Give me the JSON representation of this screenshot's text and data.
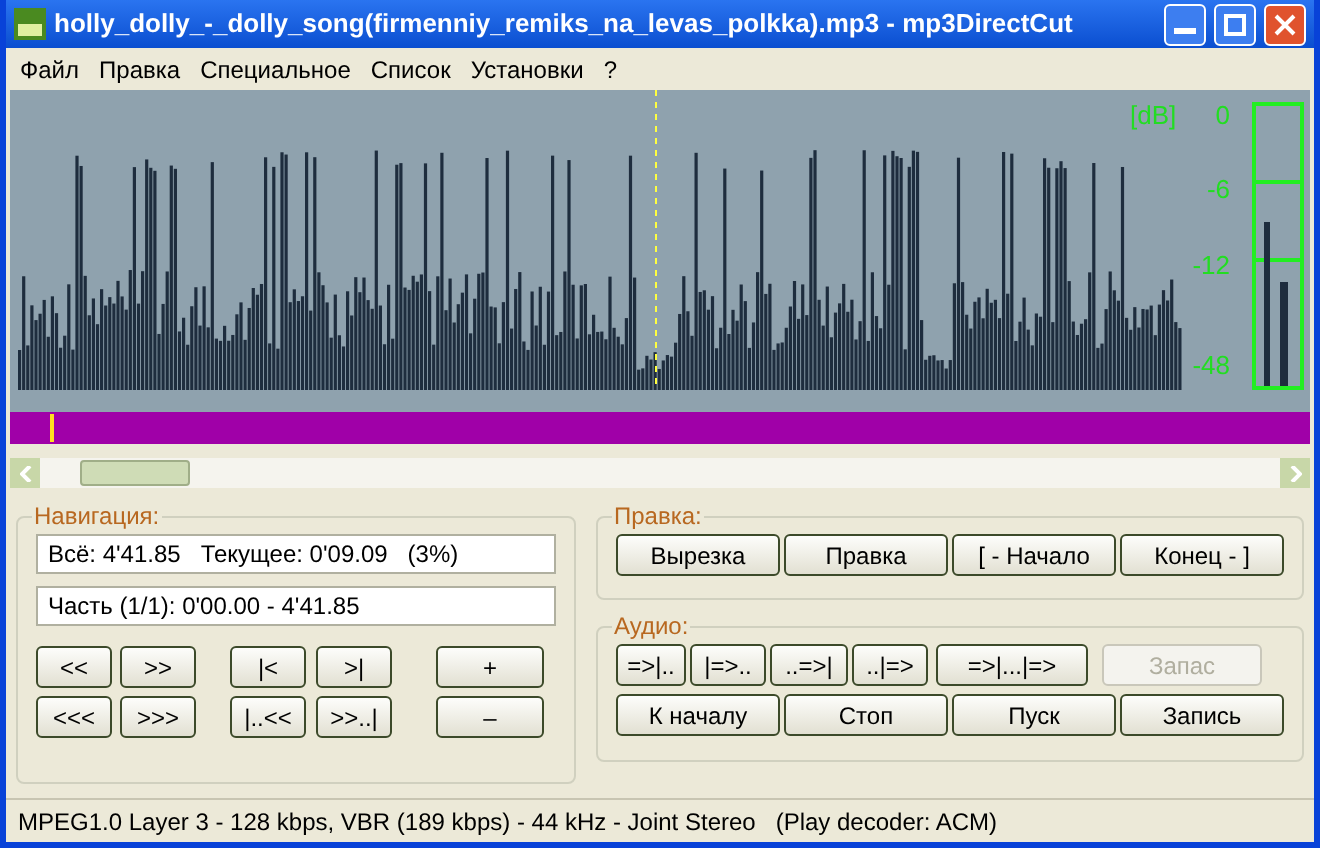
{
  "window": {
    "title": "holly_dolly_-_dolly_song(firmenniy_remiks_na_levas_polkka).mp3 - mp3DirectCut"
  },
  "menu": [
    "Файл",
    "Правка",
    "Специальное",
    "Список",
    "Установки",
    "?"
  ],
  "meter": {
    "unit": "[dB]",
    "ticks": [
      "0",
      "-6",
      "-12",
      "-48"
    ]
  },
  "timeline": {
    "position": {
      "level": 0.03
    }
  },
  "navigation": {
    "title": "Навигация:",
    "total": "Всё: 4'41.85   Текущее: 0'09.09   (3%)",
    "part": "Часть (1/1): 0'00.00 - 4'41.85",
    "buttons": [
      [
        "<<",
        ">>",
        "|<",
        ">|",
        "+"
      ],
      [
        "<<<",
        ">>>",
        "|..<<",
        ">>..|",
        "–"
      ]
    ]
  },
  "edit": {
    "title": "Правка:",
    "buttons": [
      "Вырезка",
      "Правка",
      "[ - Начало",
      "Конец - ]"
    ]
  },
  "audio": {
    "title": "Аудио:",
    "marker_buttons": [
      {
        "label": "=>|..",
        "disabled": false
      },
      {
        "label": "|=>..",
        "disabled": false
      },
      {
        "label": "..=>|",
        "disabled": false
      },
      {
        "label": "..|=>",
        "disabled": false
      },
      {
        "label": "=>|...|=>",
        "disabled": false
      },
      {
        "label": "Запас",
        "disabled": true
      }
    ],
    "transport_buttons": [
      {
        "label": "К началу",
        "disabled": false
      },
      {
        "label": "Стоп",
        "disabled": false
      },
      {
        "label": "Пуск",
        "disabled": false
      },
      {
        "label": "Запись",
        "disabled": false
      }
    ]
  },
  "status_bar": "MPEG1.0 Layer 3 - 128 kbps, VBR (189 kbps) - 44 kHz - Joint Stereo   (Play decoder: ACM)"
}
